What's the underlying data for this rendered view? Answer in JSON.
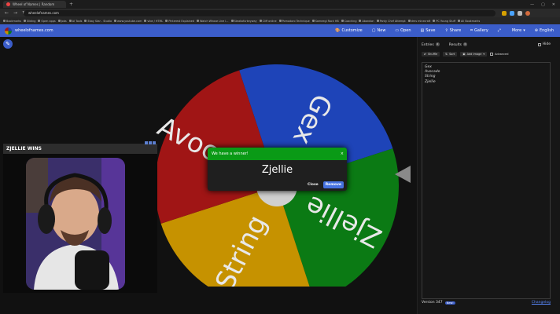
{
  "browser": {
    "tab_title": "Wheel of Names | Random",
    "address": "wheelofnames.com",
    "bookmarks": [
      "Bookmarks",
      "Sliding",
      "Open apps",
      "Jobs",
      "AI Tools",
      "Ebay Star - Studio",
      "www.youtube.com",
      "vibe / HTML",
      "Pinterest Explained",
      "Watch Whose Line i...",
      "Steakofurkeyway",
      "Cliff online",
      "Pomodoro Technique",
      "Sameegi Rock HB",
      "Coaching",
      "Abandon",
      "Panty Chef Attempt",
      "dms minecraft",
      "PC Young Stuff",
      "All Bookmarks"
    ],
    "colors": {
      "tab_favicon": "#e44444"
    }
  },
  "app": {
    "logo_text": "wheelofnames.com",
    "menu": [
      {
        "icon": "palette-icon",
        "label": "Customize"
      },
      {
        "icon": "new-file-icon",
        "label": "New"
      },
      {
        "icon": "folder-open-icon",
        "label": "Open"
      },
      {
        "icon": "save-icon",
        "label": "Save"
      },
      {
        "icon": "share-icon",
        "label": "Share"
      },
      {
        "icon": "gallery-icon",
        "label": "Gallery"
      },
      {
        "icon": "fullscreen-icon",
        "label": ""
      },
      {
        "icon": "chevron-down-icon",
        "label": "More"
      },
      {
        "icon": "globe-icon",
        "label": "English"
      }
    ],
    "accent": "#3b5dc9"
  },
  "wheel": {
    "segments": [
      {
        "label": "Gex",
        "color": "#1e44b8"
      },
      {
        "label": "Zjellie",
        "color": "#0b7a14"
      },
      {
        "label": "String",
        "color": "#c69200"
      },
      {
        "label": "Avocado",
        "color": "#a01515"
      }
    ]
  },
  "webcam": {
    "title": "ZJELLIE WINS"
  },
  "modal": {
    "heading": "We have a winner!",
    "winner": "Zjellie",
    "close_label": "Close",
    "remove_label": "Remove",
    "close_x": "×"
  },
  "panel": {
    "tabs": [
      {
        "label": "Entries",
        "count": "4"
      },
      {
        "label": "Results",
        "count": "0"
      }
    ],
    "hide_label": "Hide",
    "tools": [
      {
        "icon": "shuffle-icon",
        "label": "Shuffle"
      },
      {
        "icon": "sort-icon",
        "label": "Sort"
      },
      {
        "icon": "image-icon",
        "label": "Add image"
      }
    ],
    "advanced_label": "Advanced",
    "entries": [
      "Gex",
      "Avocado",
      "String",
      "Zjellie"
    ],
    "version": "Version 347",
    "version_badge": "New!",
    "changelog": "Changelog"
  }
}
